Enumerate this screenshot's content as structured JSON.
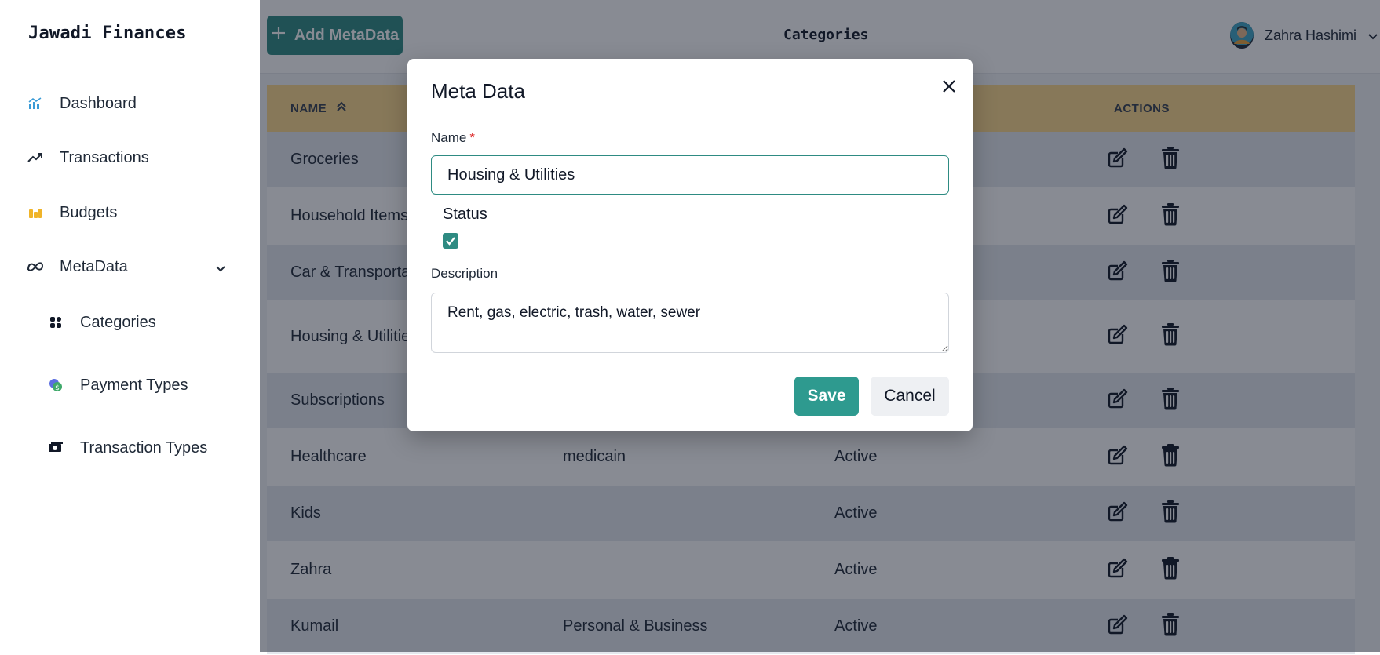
{
  "app": {
    "brand": "Jawadi Finances"
  },
  "sidebar": {
    "items": [
      {
        "label": "Dashboard",
        "icon": "chart-icon"
      },
      {
        "label": "Transactions",
        "icon": "trending-up-icon"
      },
      {
        "label": "Budgets",
        "icon": "coins-icon"
      },
      {
        "label": "MetaData",
        "icon": "meta-icon"
      }
    ],
    "sub_items": [
      {
        "label": "Categories",
        "icon": "grid-icon"
      },
      {
        "label": "Payment Types",
        "icon": "money-icon"
      },
      {
        "label": "Transaction Types",
        "icon": "cash-icon"
      }
    ]
  },
  "header": {
    "add_button": "Add MetaData",
    "title": "Categories",
    "user_name": "Zahra Hashimi"
  },
  "table": {
    "headers": {
      "name": "NAME",
      "actions": "ACTIONS"
    },
    "rows": [
      {
        "name": "Groceries",
        "description": "",
        "status": ""
      },
      {
        "name": "Household Items",
        "description": "",
        "status": ""
      },
      {
        "name": "Car & Transporta",
        "description": "",
        "status": ""
      },
      {
        "name": "Housing & Utilitie",
        "description": "",
        "status": ""
      },
      {
        "name": "Subscriptions",
        "description": "",
        "status": ""
      },
      {
        "name": "Healthcare",
        "description": "medicain",
        "status": "Active"
      },
      {
        "name": "Kids",
        "description": "",
        "status": "Active"
      },
      {
        "name": "Zahra",
        "description": "",
        "status": "Active"
      },
      {
        "name": "Kumail",
        "description": "Personal & Business",
        "status": "Active"
      }
    ]
  },
  "modal": {
    "title": "Meta Data",
    "name_label": "Name",
    "required_mark": "*",
    "name_value": "Housing & Utilities",
    "status_label": "Status",
    "status_checked": true,
    "description_label": "Description",
    "description_value": "Rent, gas, electric, trash, water, sewer",
    "save_label": "Save",
    "cancel_label": "Cancel"
  },
  "colors": {
    "accent": "#2e8b82",
    "table_header": "#fcd98a",
    "required": "#dc2626"
  }
}
